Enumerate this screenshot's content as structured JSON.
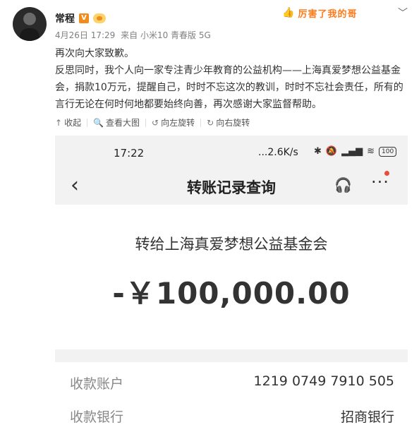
{
  "post": {
    "author": "常程",
    "verified_badge": "V",
    "date": "4月26日 17:29",
    "source": "来自 小米10 青春版 5G",
    "sticker_text": "厉害了我的哥",
    "paragraphs": [
      "再次向大家致歉。",
      "反思同时，我个人向一家专注青少年教育的公益机构——上海真爱梦想公益基金会，捐款10万元，提醒自己，时时不忘这次的教训，时时不忘社会责任，所有的言行无论在何时何地都要始终向善，再次感谢大家监督帮助。"
    ]
  },
  "toolbar": {
    "collapse": "收起",
    "view_large": "查看大图",
    "rotate_left": "向左旋转",
    "rotate_right": "向右旋转"
  },
  "phone": {
    "status_time": "17:22",
    "net_rate": "...2.6K/s",
    "battery": "100",
    "nav_title": "转账记录查询",
    "recipient": "转给上海真爱梦想公益基金会",
    "amount": "-￥100,000.00",
    "rows": [
      {
        "label": "收款账户",
        "value": "1219 0749 7910 505"
      },
      {
        "label": "收款银行",
        "value": "招商银行"
      }
    ]
  },
  "colors": {
    "badge_orange": "#f08c1b",
    "notify_red": "#e74c3c",
    "phone_bg": "#f2f2f2"
  },
  "icons": [
    "chevron-down-icon",
    "collapse-icon",
    "zoom-icon",
    "rotate-left-icon",
    "rotate-right-icon",
    "back-icon",
    "headset-icon",
    "more-icon"
  ]
}
